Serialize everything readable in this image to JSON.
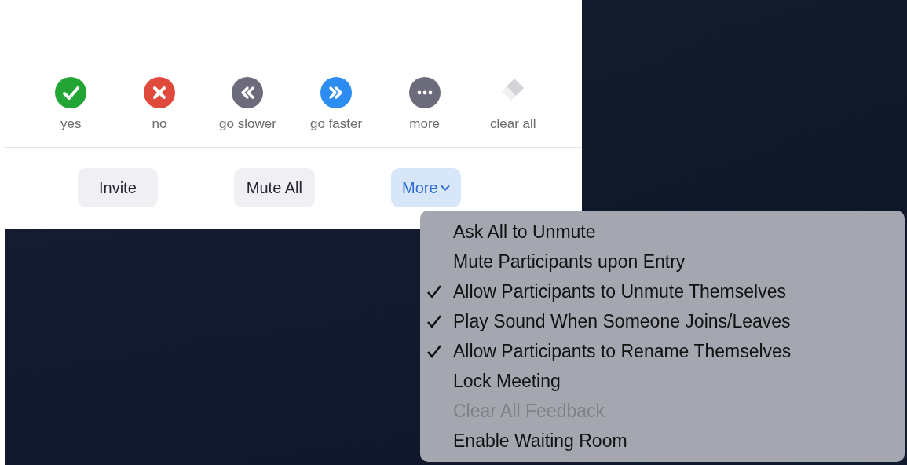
{
  "reactions": [
    {
      "kind": "check",
      "label": "yes",
      "color": "#22a534"
    },
    {
      "kind": "cross",
      "label": "no",
      "color": "#e04a3c"
    },
    {
      "kind": "rewind",
      "label": "go slower",
      "color": "#6b6b7b"
    },
    {
      "kind": "forward",
      "label": "go faster",
      "color": "#2d8cf0"
    },
    {
      "kind": "dots",
      "label": "more",
      "color": "#6b6b7b"
    },
    {
      "kind": "eraser",
      "label": "clear all",
      "color": "#d4d4d8"
    }
  ],
  "buttons": [
    {
      "label": "Invite",
      "selected": false,
      "dropdown": false
    },
    {
      "label": "Mute All",
      "selected": false,
      "dropdown": false
    },
    {
      "label": "More",
      "selected": true,
      "dropdown": true
    }
  ],
  "menu": [
    {
      "label": "Ask All to Unmute",
      "checked": false,
      "disabled": false
    },
    {
      "label": "Mute Participants upon Entry",
      "checked": false,
      "disabled": false
    },
    {
      "label": "Allow Participants to Unmute Themselves",
      "checked": true,
      "disabled": false
    },
    {
      "label": "Play Sound When Someone Joins/Leaves",
      "checked": true,
      "disabled": false
    },
    {
      "label": "Allow Participants to Rename Themselves",
      "checked": true,
      "disabled": false
    },
    {
      "label": "Lock Meeting",
      "checked": false,
      "disabled": false
    },
    {
      "label": "Clear All Feedback",
      "checked": false,
      "disabled": true
    },
    {
      "label": "Enable Waiting Room",
      "checked": false,
      "disabled": false
    }
  ]
}
